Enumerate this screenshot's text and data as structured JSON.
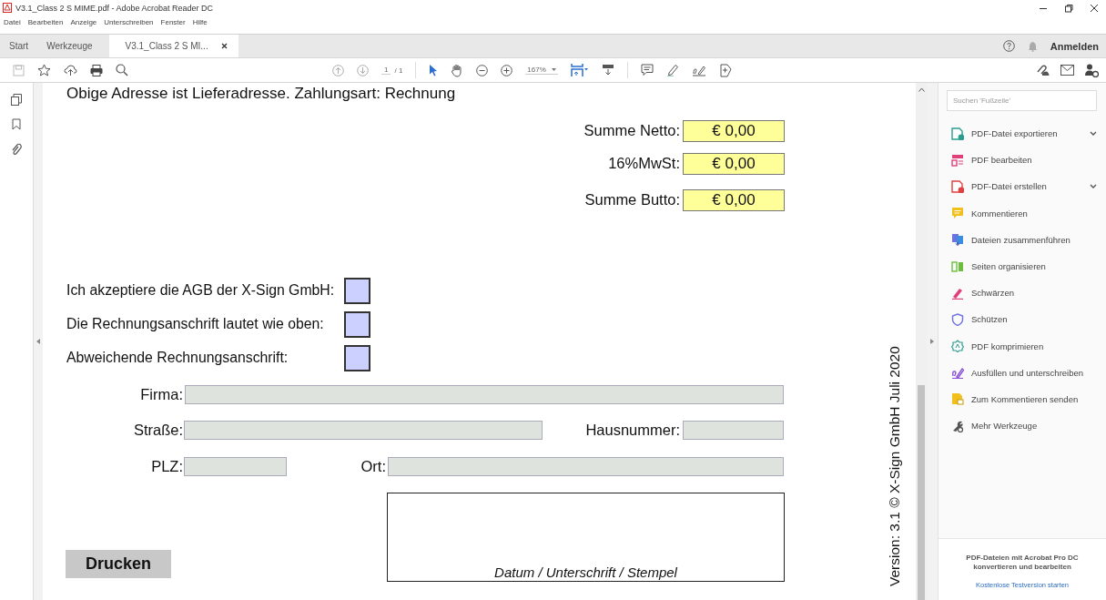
{
  "window": {
    "title": "V3.1_Class 2 S MIME.pdf - Adobe Acrobat Reader DC"
  },
  "menu": [
    "Datei",
    "Bearbeiten",
    "Anzeige",
    "Unterschreiben",
    "Fenster",
    "Hilfe"
  ],
  "tabs": [
    {
      "label": "Start",
      "selected": false
    },
    {
      "label": "Werkzeuge",
      "selected": false
    },
    {
      "label": "V3.1_Class 2 S MI...",
      "selected": true
    }
  ],
  "account": {
    "sign_in": "Anmelden"
  },
  "toolbar": {
    "page": "1",
    "page_total": "/ 1",
    "zoom": "167%"
  },
  "document": {
    "note": "Obige Adresse ist Lieferadresse. Zahlungsart: Rechnung",
    "totals": [
      {
        "label": "Summe Netto:",
        "value": "€ 0,00"
      },
      {
        "label": "16%MwSt:",
        "value": "€ 0,00"
      },
      {
        "label": "Summe Butto:",
        "value": "€ 0,00"
      }
    ],
    "checkboxes": [
      {
        "label": "Ich akzeptiere die AGB der X-Sign GmbH:",
        "checked": false
      },
      {
        "label": "Die Rechnungsanschrift lautet wie oben:",
        "checked": false
      },
      {
        "label": "Abweichende Rechnungsanschrift:",
        "checked": false
      }
    ],
    "address_fields": [
      {
        "label": "Firma:"
      },
      {
        "label": "Straße:"
      },
      {
        "label": "Hausnummer:"
      },
      {
        "label": "PLZ:"
      },
      {
        "label": "Ort:"
      }
    ],
    "signature_caption": "Datum / Unterschrift / Stempel",
    "print_button": "Drucken",
    "version": "Version: 3.1 © X-Sign GmbH Juli 2020"
  },
  "tools_pane": {
    "search": {
      "placeholder": "Suchen 'Fußzeile'"
    },
    "tools": [
      {
        "label": "PDF-Datei exportieren",
        "has_submenu": true
      },
      {
        "label": "PDF bearbeiten",
        "has_submenu": false
      },
      {
        "label": "PDF-Datei erstellen",
        "has_submenu": true
      },
      {
        "label": "Kommentieren",
        "has_submenu": false
      },
      {
        "label": "Dateien zusammenführen",
        "has_submenu": false
      },
      {
        "label": "Seiten organisieren",
        "has_submenu": false
      },
      {
        "label": "Schwärzen",
        "has_submenu": false
      },
      {
        "label": "Schützen",
        "has_submenu": false
      },
      {
        "label": "PDF komprimieren",
        "has_submenu": false
      },
      {
        "label": "Ausfüllen und unterschreiben",
        "has_submenu": false
      },
      {
        "label": "Zum Kommentieren senden",
        "has_submenu": false
      },
      {
        "label": "Mehr Werkzeuge",
        "has_submenu": false
      }
    ],
    "promo": {
      "text": "PDF-Dateien mit Acrobat Pro DC konvertieren und bearbeiten",
      "link": "Kostenlose Testversion starten"
    }
  }
}
